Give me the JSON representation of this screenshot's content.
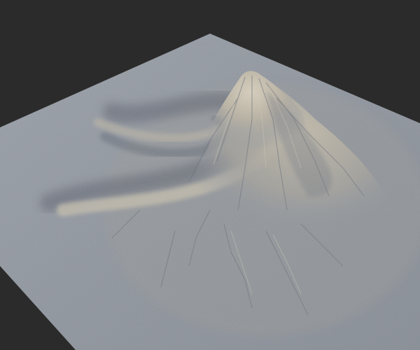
{
  "viewport": {
    "background_color": "#2b2b2b",
    "terrain_base_color": "#8e949d",
    "terrain_light_color": "#c9c0ad",
    "terrain_shadow_color": "#5e6470"
  }
}
